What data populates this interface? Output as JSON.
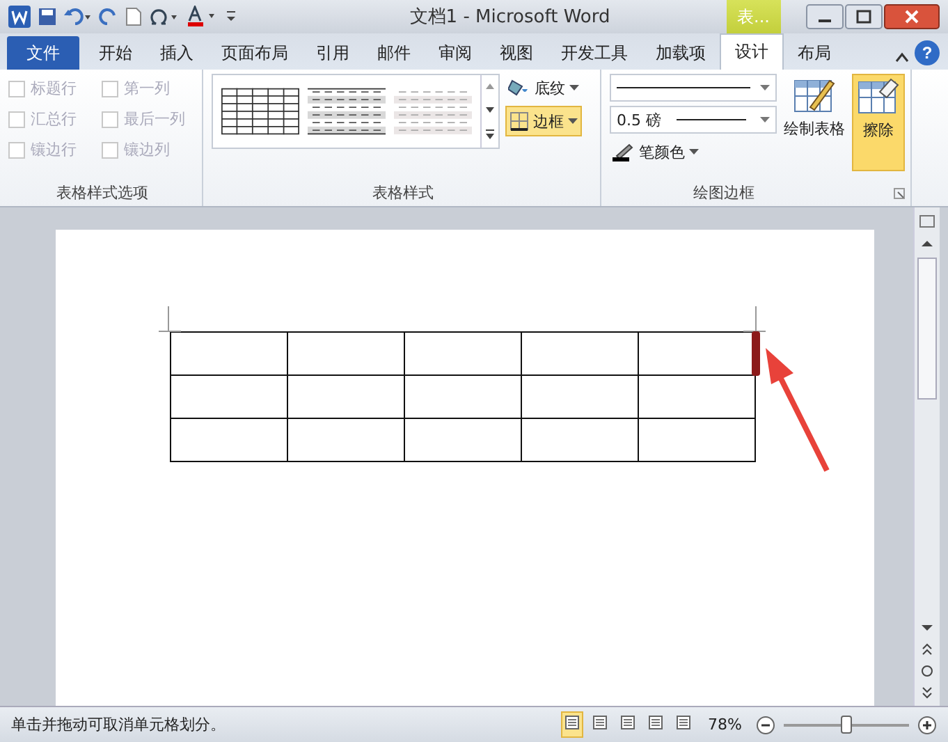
{
  "window": {
    "title": "文档1 - Microsoft Word",
    "contextual_tab": "表...",
    "help": "?"
  },
  "tabs": [
    {
      "label": "文件",
      "kind": "file",
      "selected": false
    },
    {
      "label": "开始",
      "kind": "normal",
      "selected": false
    },
    {
      "label": "插入",
      "kind": "normal",
      "selected": false
    },
    {
      "label": "页面布局",
      "kind": "normal",
      "selected": false
    },
    {
      "label": "引用",
      "kind": "normal",
      "selected": false
    },
    {
      "label": "邮件",
      "kind": "normal",
      "selected": false
    },
    {
      "label": "审阅",
      "kind": "normal",
      "selected": false
    },
    {
      "label": "视图",
      "kind": "normal",
      "selected": false
    },
    {
      "label": "开发工具",
      "kind": "normal",
      "selected": false
    },
    {
      "label": "加载项",
      "kind": "normal",
      "selected": false
    },
    {
      "label": "设计",
      "kind": "normal",
      "selected": true
    },
    {
      "label": "布局",
      "kind": "normal",
      "selected": false
    }
  ],
  "ribbon": {
    "style_options": {
      "label": "表格样式选项",
      "options": [
        {
          "label": "标题行",
          "checked": false,
          "disabled": true
        },
        {
          "label": "第一列",
          "checked": false,
          "disabled": true
        },
        {
          "label": "汇总行",
          "checked": false,
          "disabled": true
        },
        {
          "label": "最后一列",
          "checked": false,
          "disabled": true
        },
        {
          "label": "镶边行",
          "checked": false,
          "disabled": true
        },
        {
          "label": "镶边列",
          "checked": false,
          "disabled": true
        }
      ]
    },
    "table_styles": {
      "label": "表格样式",
      "shading": "底纹",
      "borders": {
        "label": "边框",
        "selected": true
      }
    },
    "draw_borders": {
      "label": "绘图边框",
      "line_weight": "0.5 磅",
      "pen_color": "笔颜色",
      "draw_table": {
        "label": "绘制表格",
        "selected": false
      },
      "eraser": {
        "label": "擦除",
        "selected": true
      }
    }
  },
  "status_bar": {
    "message": "单击并拖动可取消单元格划分。",
    "zoom": "78%",
    "zoom_slider": {
      "level": 0.5
    },
    "views": [
      {
        "selected": true
      },
      {
        "selected": false
      },
      {
        "selected": false
      },
      {
        "selected": false
      },
      {
        "selected": false
      }
    ]
  }
}
